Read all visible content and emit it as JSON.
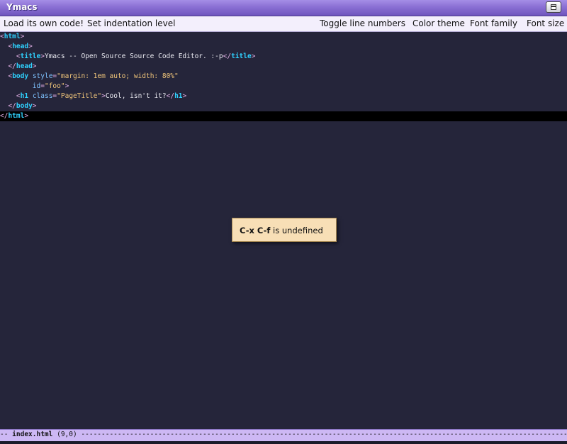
{
  "window": {
    "title": "Ymacs"
  },
  "menu": {
    "left": [
      "Load its own code!",
      "Set indentation level"
    ],
    "right": [
      "Toggle line numbers",
      "Color theme",
      "Font family",
      "Font size"
    ]
  },
  "editor": {
    "doc_title_text": "Ymacs -- Open Source Source Code Editor. :-p",
    "body_style_value": "\"margin: 1em auto; width: 80%\"",
    "body_id_value": "\"foo\"",
    "h1_class_value": "\"PageTitle\"",
    "h1_text": "Cool, isn't it?"
  },
  "popup": {
    "keys": "C-x C-f",
    "message": " is undefined"
  },
  "modeline": {
    "prefix": "-- ",
    "filename": "index.html",
    "position": " (9,0) ",
    "fill": "------------------------------------------------------------------------------------------------------------------------------"
  },
  "colors": {
    "editor_bg": "#25253a",
    "tag_name": "#2fd2ff",
    "attr_value": "#f0c57a",
    "titlebar": "#8a6fd4",
    "popup_bg": "#f8dfb6"
  }
}
